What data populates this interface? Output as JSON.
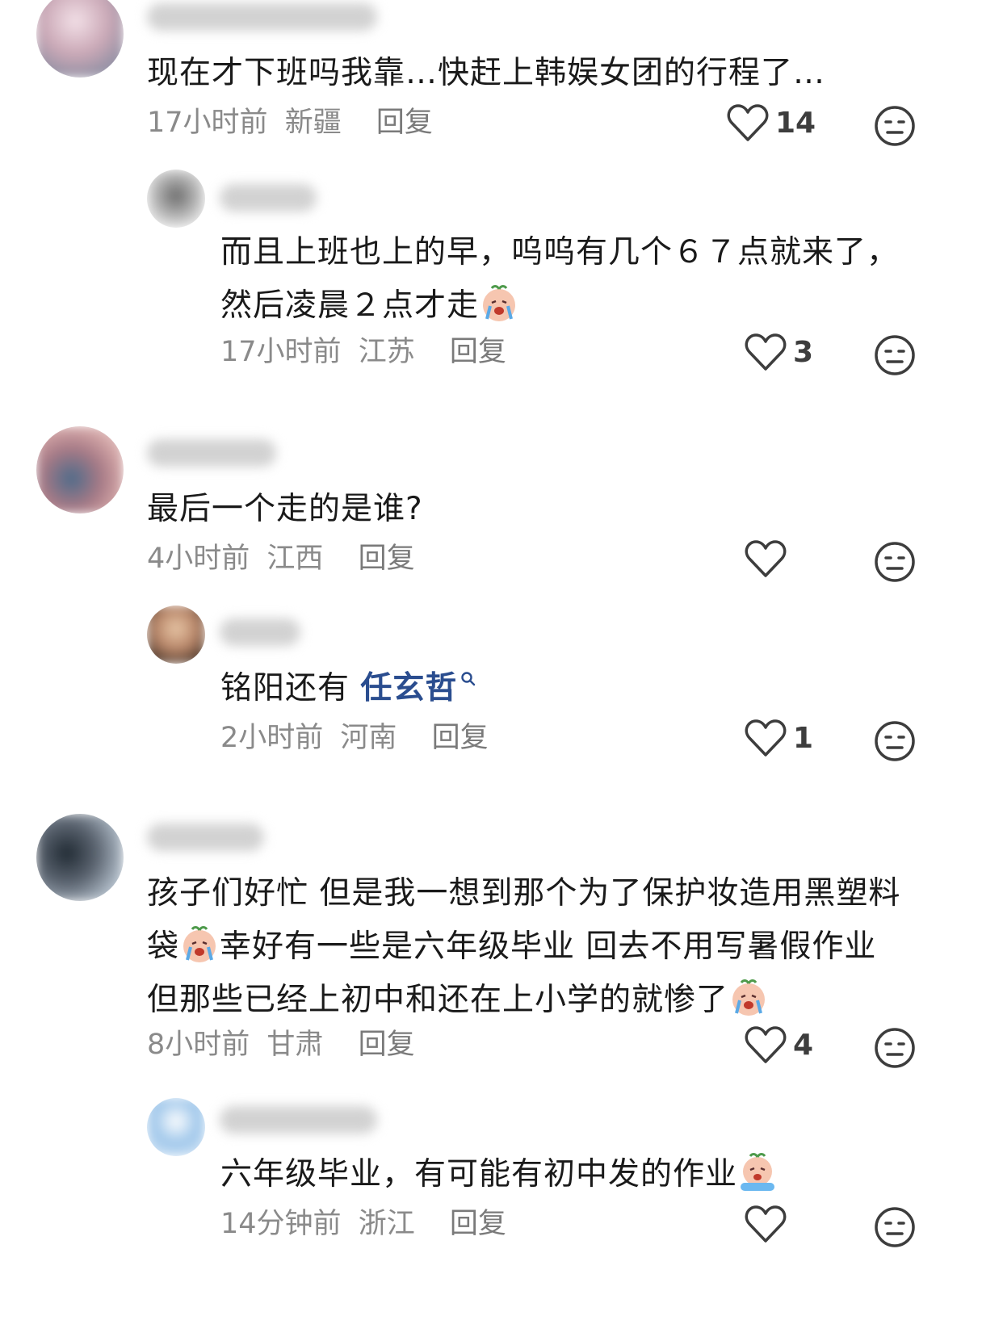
{
  "comments": [
    {
      "text_lines": [
        "现在才下班吗我靠…快赶上韩娱女团的行程了…"
      ],
      "time": "17小时前",
      "location": "新疆",
      "reply_label": "回复",
      "likes": "14",
      "avatar_color": "#c9b9c4"
    },
    {
      "text_lines": [
        "而且上班也上的早，呜呜有几个６７点就来了，",
        "然后凌晨２点才走"
      ],
      "time": "17小时前",
      "location": "江苏",
      "reply_label": "回复",
      "likes": "3",
      "avatar_color": "#cfcfcf"
    },
    {
      "text_lines": [
        "最后一个走的是谁?"
      ],
      "time": "4小时前",
      "location": "江西",
      "reply_label": "回复",
      "likes": "",
      "avatar_color": "#b47b7b"
    },
    {
      "text_prefix": "铭阳还有",
      "mention": "任玄哲",
      "time": "2小时前",
      "location": "河南",
      "reply_label": "回复",
      "likes": "1",
      "avatar_color": "#b9876a"
    },
    {
      "text_lines": [
        "孩子们好忙 但是我一想到那个为了保护妆造用黑塑料",
        "袋",
        "幸好有一些是六年级毕业 回去不用写暑假作业",
        "但那些已经上初中和还在上小学的就惨了"
      ],
      "time": "8小时前",
      "location": "甘肃",
      "reply_label": "回复",
      "likes": "4",
      "avatar_color": "#5b6470"
    },
    {
      "text_lines": [
        "六年级毕业，有可能有初中发的作业"
      ],
      "time": "14分钟前",
      "location": "浙江",
      "reply_label": "回复",
      "likes": "",
      "avatar_color": "#9ec6ea"
    }
  ],
  "icons": {
    "like": "heart-outline-icon",
    "dislike": "meh-face-icon",
    "emoji": "crying-emoji-icon",
    "search": "search-icon"
  },
  "colors": {
    "text": "#1a1a1a",
    "meta": "#8a8a8a",
    "mention": "#2a4d8f",
    "icon": "#3d3d3d"
  }
}
